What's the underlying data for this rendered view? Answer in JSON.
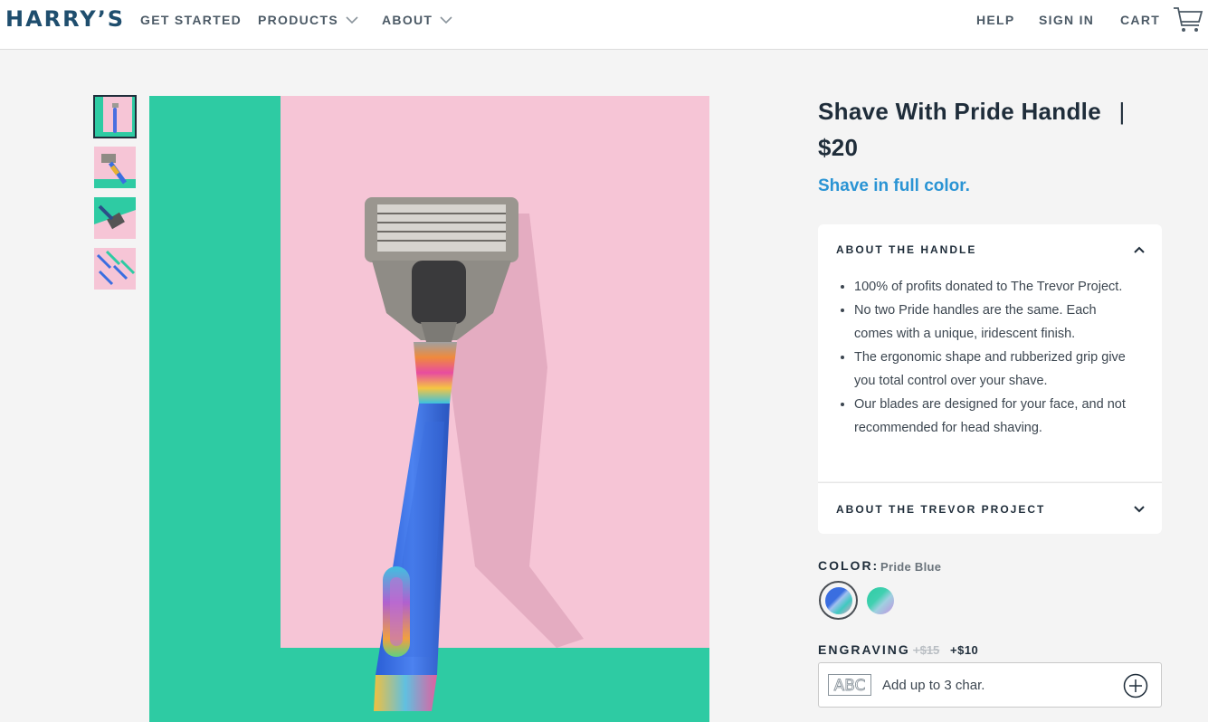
{
  "header": {
    "logo": "HARRY’S",
    "nav": [
      "GET STARTED",
      "PRODUCTS",
      "ABOUT"
    ],
    "right_nav": [
      "HELP",
      "SIGN IN",
      "CART"
    ]
  },
  "product": {
    "title_line1": "Shave With Pride Handle",
    "separator": "|",
    "price": "$20",
    "tagline": "Shave in full color."
  },
  "accordion": {
    "handle_title": "ABOUT THE HANDLE",
    "handle_points": [
      "100% of profits donated to The Trevor Project.",
      "No two Pride handles are the same. Each comes with a unique, iridescent finish.",
      "The ergonomic shape and rubberized grip give you total control over your shave.",
      "Our blades are designed for your face, and not recommended for head shaving."
    ],
    "trevor_title": "ABOUT THE TREVOR PROJECT"
  },
  "color": {
    "label": "COLOR:",
    "value": "Pride Blue"
  },
  "engraving": {
    "label": "ENGRAVING",
    "old_price": "+$15",
    "new_price": "+$10",
    "icon_text": "ABC",
    "placeholder": "Add up to 3 char."
  },
  "colors": {
    "brand_navy": "#1f4e6e",
    "tagline_blue": "#2a94d4",
    "image_green": "#2ecba3",
    "image_pink": "#f6c5d6"
  }
}
